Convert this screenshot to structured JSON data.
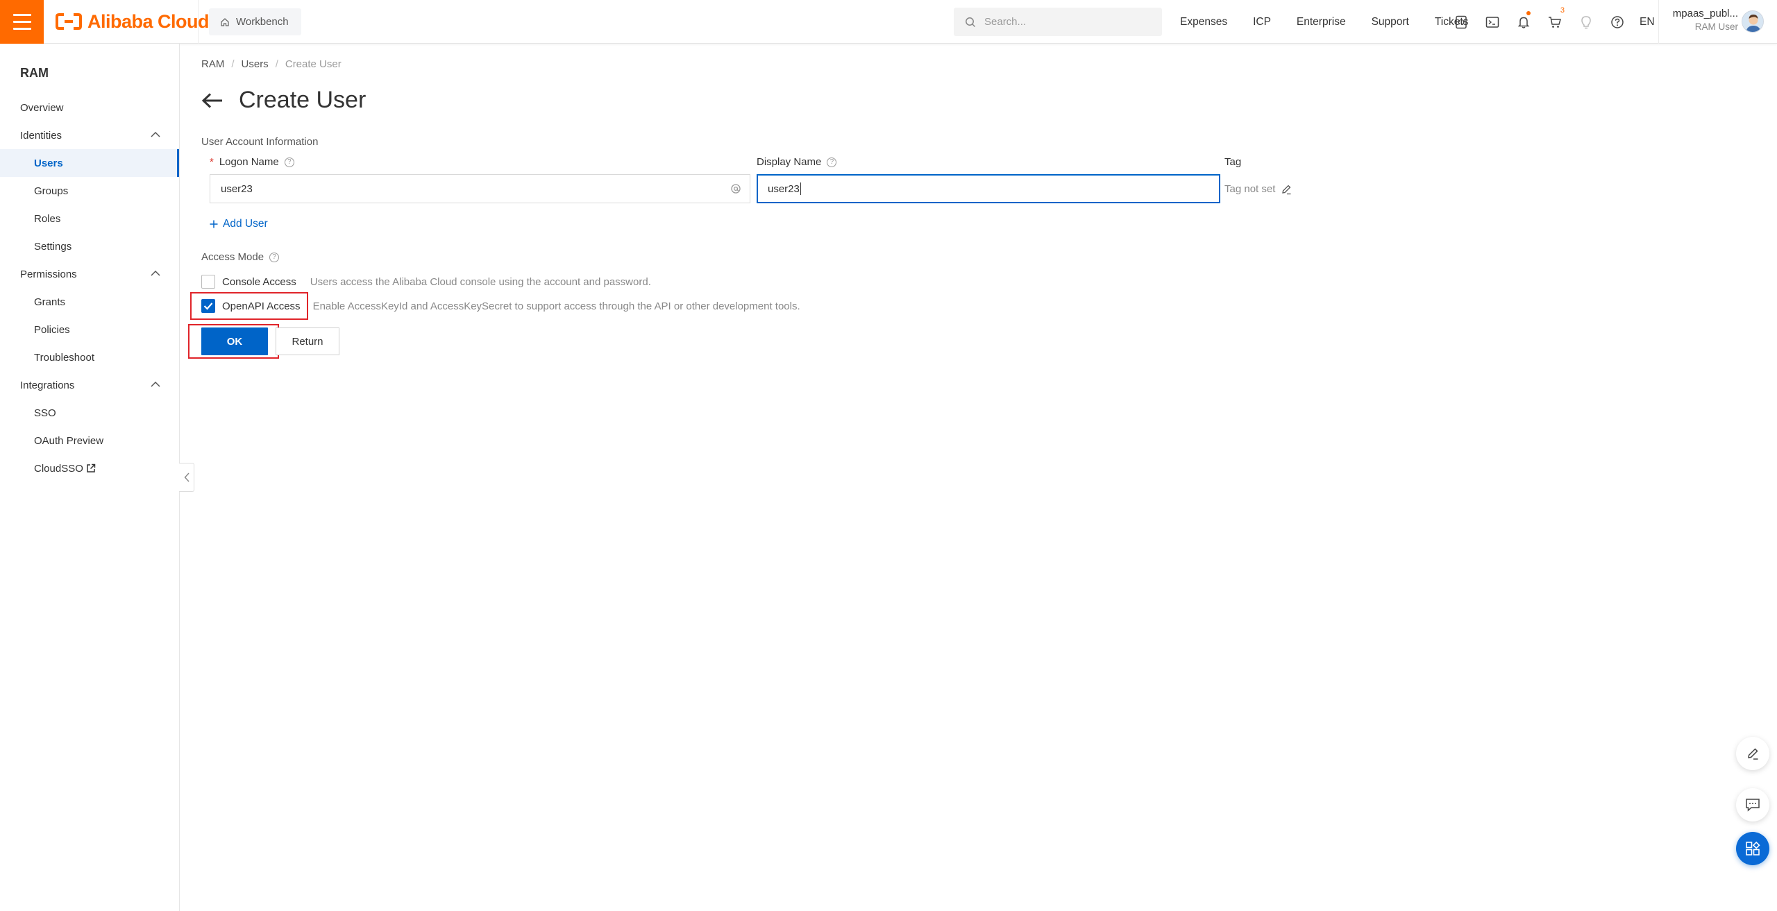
{
  "brand": {
    "name": "Alibaba Cloud",
    "accent": "#ff6a00",
    "primary": "#0064c8"
  },
  "topbar": {
    "workbench_label": "Workbench",
    "search_placeholder": "Search...",
    "nav": [
      "Expenses",
      "ICP",
      "Enterprise",
      "Support",
      "Tickets"
    ],
    "icons": [
      "code-icon",
      "terminal-icon",
      "bell-icon",
      "cart-icon",
      "lightbulb-icon",
      "help-icon"
    ],
    "cart_count": "3",
    "language": "EN",
    "user_name": "mpaas_publ...",
    "user_role": "RAM User"
  },
  "sidebar": {
    "title": "RAM",
    "items": [
      {
        "label": "Overview",
        "level": "top"
      },
      {
        "label": "Identities",
        "level": "top",
        "expanded": true
      },
      {
        "label": "Users",
        "level": "sub",
        "active": true
      },
      {
        "label": "Groups",
        "level": "sub"
      },
      {
        "label": "Roles",
        "level": "sub"
      },
      {
        "label": "Settings",
        "level": "sub"
      },
      {
        "label": "Permissions",
        "level": "top",
        "expanded": true
      },
      {
        "label": "Grants",
        "level": "sub"
      },
      {
        "label": "Policies",
        "level": "sub"
      },
      {
        "label": "Troubleshoot",
        "level": "sub"
      },
      {
        "label": "Integrations",
        "level": "top",
        "expanded": true
      },
      {
        "label": "SSO",
        "level": "sub"
      },
      {
        "label": "OAuth Preview",
        "level": "sub"
      },
      {
        "label": "CloudSSO",
        "level": "sub",
        "external": true
      }
    ]
  },
  "breadcrumb": [
    "RAM",
    "Users",
    "Create User"
  ],
  "page": {
    "title": "Create User",
    "section_label": "User Account Information",
    "logon_name_label": "Logon Name",
    "logon_name_value": "user23",
    "display_name_label": "Display Name",
    "display_name_value": "user23",
    "tag_label": "Tag",
    "tag_value": "Tag not set",
    "add_user_label": "Add User",
    "access_mode_label": "Access Mode",
    "console_access_label": "Console Access",
    "console_access_desc": "Users access the Alibaba Cloud console using the account and password.",
    "console_access_checked": false,
    "openapi_access_label": "OpenAPI Access",
    "openapi_access_desc": "Enable AccessKeyId and AccessKeySecret to support access through the API or other development tools.",
    "openapi_access_checked": true,
    "ok_label": "OK",
    "return_label": "Return"
  },
  "floating": [
    "edit-icon",
    "feedback-icon",
    "apps-icon"
  ]
}
